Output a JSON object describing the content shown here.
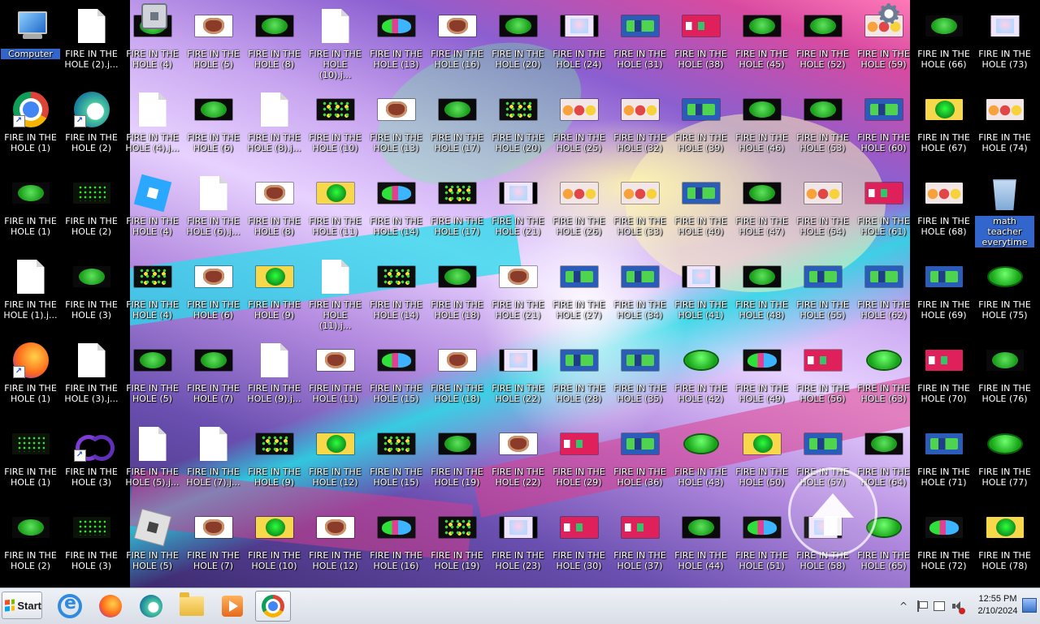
{
  "desktop": {
    "label_fire": "FIRE IN THE HOLE",
    "left_icons": [
      {
        "label": "Computer",
        "icon": "computer-icon",
        "selected": true
      },
      {
        "label": "FIRE IN THE HOLE (2).j...",
        "icon": "file-icon"
      },
      {
        "label": "FIRE IN THE HOLE (1)",
        "icon": "chrome-icon",
        "shortcut": true
      },
      {
        "label": "FIRE IN THE HOLE (2)",
        "icon": "edge-icon",
        "shortcut": true
      },
      {
        "label": "FIRE IN THE HOLE (1)",
        "icon": "th-green"
      },
      {
        "label": "FIRE IN THE HOLE (2)",
        "icon": "th-grid"
      },
      {
        "label": "FIRE IN THE HOLE (1).j...",
        "icon": "file-icon"
      },
      {
        "label": "FIRE IN THE HOLE (3)",
        "icon": "th-green"
      },
      {
        "label": "FIRE IN THE HOLE (1)",
        "icon": "firefox-icon",
        "shortcut": true
      },
      {
        "label": "FIRE IN THE HOLE (3).j...",
        "icon": "file-icon"
      },
      {
        "label": "FIRE IN THE HOLE (1)",
        "icon": "th-grid"
      },
      {
        "label": "FIRE IN THE HOLE (3)",
        "icon": "visual-studio-icon",
        "shortcut": true
      },
      {
        "label": "FIRE IN THE HOLE (2)",
        "icon": "th-green"
      },
      {
        "label": "FIRE IN THE HOLE (3)",
        "icon": "th-grid"
      }
    ],
    "columns": [
      [
        "FIRE IN THE HOLE (4)",
        "FIRE IN THE HOLE (4).j...",
        "FIRE IN THE HOLE (4)",
        "FIRE IN THE HOLE (4)",
        "FIRE IN THE HOLE (5)",
        "FIRE IN THE HOLE (5).j...",
        "FIRE IN THE HOLE (5)"
      ],
      [
        "FIRE IN THE HOLE (5)",
        "FIRE IN THE HOLE (6)",
        "FIRE IN THE HOLE (6).j...",
        "FIRE IN THE HOLE (6)",
        "FIRE IN THE HOLE (7)",
        "FIRE IN THE HOLE (7).j...",
        "FIRE IN THE HOLE (7)"
      ],
      [
        "FIRE IN THE HOLE (8)",
        "FIRE IN THE HOLE (8).j...",
        "FIRE IN THE HOLE (8)",
        "FIRE IN THE HOLE (9)",
        "FIRE IN THE HOLE (9).j...",
        "FIRE IN THE HOLE (9)",
        "FIRE IN THE HOLE (10)"
      ],
      [
        "FIRE IN THE HOLE (10).j...",
        "FIRE IN THE HOLE (10)",
        "FIRE IN THE HOLE (11)",
        "FIRE IN THE HOLE (11).j...",
        "FIRE IN THE HOLE (11)",
        "FIRE IN THE HOLE (12)",
        "FIRE IN THE HOLE (12)"
      ],
      [
        "FIRE IN THE HOLE (13)",
        "FIRE IN THE HOLE (13)",
        "FIRE IN THE HOLE (14)",
        "FIRE IN THE HOLE (14)",
        "FIRE IN THE HOLE (15)",
        "FIRE IN THE HOLE (15)",
        "FIRE IN THE HOLE (16)"
      ],
      [
        "FIRE IN THE HOLE (16)",
        "FIRE IN THE HOLE (17)",
        "FIRE IN THE HOLE (17)",
        "FIRE IN THE HOLE (18)",
        "FIRE IN THE HOLE (18)",
        "FIRE IN THE HOLE (19)",
        "FIRE IN THE HOLE (19)"
      ],
      [
        "FIRE IN THE HOLE (20)",
        "FIRE IN THE HOLE (20)",
        "FIRE IN THE HOLE (21)",
        "FIRE IN THE HOLE (21)",
        "FIRE IN THE HOLE (22)",
        "FIRE IN THE HOLE (22)",
        "FIRE IN THE HOLE (23)"
      ],
      [
        "FIRE IN THE HOLE (24)",
        "FIRE IN THE HOLE (25)",
        "FIRE IN THE HOLE (26)",
        "FIRE IN THE HOLE (27)",
        "FIRE IN THE HOLE (28)",
        "FIRE IN THE HOLE (29)",
        "FIRE IN THE HOLE (30)"
      ],
      [
        "FIRE IN THE HOLE (31)",
        "FIRE IN THE HOLE (32)",
        "FIRE IN THE HOLE (33)",
        "FIRE IN THE HOLE (34)",
        "FIRE IN THE HOLE (35)",
        "FIRE IN THE HOLE (36)",
        "FIRE IN THE HOLE (37)"
      ],
      [
        "FIRE IN THE HOLE (38)",
        "FIRE IN THE HOLE (39)",
        "FIRE IN THE HOLE (40)",
        "FIRE IN THE HOLE (41)",
        "FIRE IN THE HOLE (42)",
        "FIRE IN THE HOLE (43)",
        "FIRE IN THE HOLE (44)"
      ],
      [
        "FIRE IN THE HOLE (45)",
        "FIRE IN THE HOLE (46)",
        "FIRE IN THE HOLE (47)",
        "FIRE IN THE HOLE (48)",
        "FIRE IN THE HOLE (49)",
        "FIRE IN THE HOLE (50)",
        "FIRE IN THE HOLE (51)"
      ],
      [
        "FIRE IN THE HOLE (52)",
        "FIRE IN THE HOLE (53)",
        "FIRE IN THE HOLE (54)",
        "FIRE IN THE HOLE (55)",
        "FIRE IN THE HOLE (56)",
        "FIRE IN THE HOLE (57)",
        "FIRE IN THE HOLE (58)"
      ],
      [
        "FIRE IN THE HOLE (59)",
        "FIRE IN THE HOLE (60)",
        "FIRE IN THE HOLE (61)",
        "FIRE IN THE HOLE (62)",
        "FIRE IN THE HOLE (63)",
        "FIRE IN THE HOLE (64)",
        "FIRE IN THE HOLE (65)"
      ]
    ],
    "column_icons": [
      [
        "th-green",
        "file-icon",
        "roblox-blue-icon",
        "th-dots",
        "th-green",
        "file-icon",
        "roblox-gray-icon"
      ],
      [
        "th-heart",
        "th-green",
        "file-icon",
        "th-heart",
        "th-green",
        "file-icon",
        "th-heart"
      ],
      [
        "th-green",
        "file-icon",
        "th-heart",
        "th-smile",
        "file-icon",
        "th-dots",
        "th-smile"
      ],
      [
        "file-icon",
        "th-dots",
        "th-smile",
        "file-icon",
        "th-heart",
        "th-smile",
        "th-heart"
      ],
      [
        "th-mixed",
        "th-heart",
        "th-mixed",
        "th-dots",
        "th-mixed",
        "th-dots",
        "th-mixed"
      ],
      [
        "th-heart",
        "th-green",
        "th-dots",
        "th-green",
        "th-heart",
        "th-green",
        "th-dots"
      ],
      [
        "th-green",
        "th-dots",
        "th-anime",
        "th-heart",
        "th-anime",
        "th-heart",
        "th-anime"
      ],
      [
        "th-anime",
        "th-faces",
        "th-faces",
        "th-blue",
        "th-blue",
        "th-pink",
        "th-pink"
      ],
      [
        "th-blue",
        "th-faces",
        "th-faces",
        "th-blue",
        "th-blue",
        "th-blue",
        "th-pink"
      ],
      [
        "th-pink",
        "th-blue",
        "th-blue",
        "th-anime",
        "th-pill",
        "th-pill",
        "th-green"
      ],
      [
        "th-green",
        "th-green",
        "th-green",
        "th-green",
        "th-mixed",
        "th-smile",
        "th-mixed"
      ],
      [
        "th-green",
        "th-green",
        "th-faces",
        "th-blue",
        "th-pink",
        "th-blue",
        "th-anime"
      ],
      [
        "th-faces",
        "th-blue",
        "th-pink",
        "th-blue",
        "th-pill",
        "th-green",
        "th-pill"
      ]
    ],
    "right_icons": [
      {
        "label": "FIRE IN THE HOLE (66)",
        "icon": "th-green"
      },
      {
        "label": "FIRE IN THE HOLE (73)",
        "icon": "th-anime"
      },
      {
        "label": "FIRE IN THE HOLE (67)",
        "icon": "th-smile"
      },
      {
        "label": "FIRE IN THE HOLE (74)",
        "icon": "th-faces"
      },
      {
        "label": "FIRE IN THE HOLE (68)",
        "icon": "th-faces"
      },
      {
        "label": "math teacher everytime",
        "icon": "recycle-bin-icon",
        "selected": true
      },
      {
        "label": "FIRE IN THE HOLE (69)",
        "icon": "th-blue"
      },
      {
        "label": "FIRE IN THE HOLE (75)",
        "icon": "th-pill"
      },
      {
        "label": "FIRE IN THE HOLE (70)",
        "icon": "th-pink"
      },
      {
        "label": "FIRE IN THE HOLE (76)",
        "icon": "th-green"
      },
      {
        "label": "FIRE IN THE HOLE (71)",
        "icon": "th-blue"
      },
      {
        "label": "FIRE IN THE HOLE (77)",
        "icon": "th-pill"
      },
      {
        "label": "FIRE IN THE HOLE (72)",
        "icon": "th-mixed"
      },
      {
        "label": "FIRE IN THE HOLE (78)",
        "icon": "th-smile"
      }
    ]
  },
  "taskbar": {
    "start_label": "Start",
    "apps": [
      {
        "name": "internet-explorer-icon",
        "active": false
      },
      {
        "name": "firefox-icon",
        "active": false
      },
      {
        "name": "edge-icon",
        "active": false
      },
      {
        "name": "folder-icon",
        "active": false
      },
      {
        "name": "media-player-icon",
        "active": false
      },
      {
        "name": "chrome-icon",
        "active": true
      }
    ],
    "time": "12:55 PM",
    "date": "2/10/2024",
    "tray_expand": "^"
  }
}
